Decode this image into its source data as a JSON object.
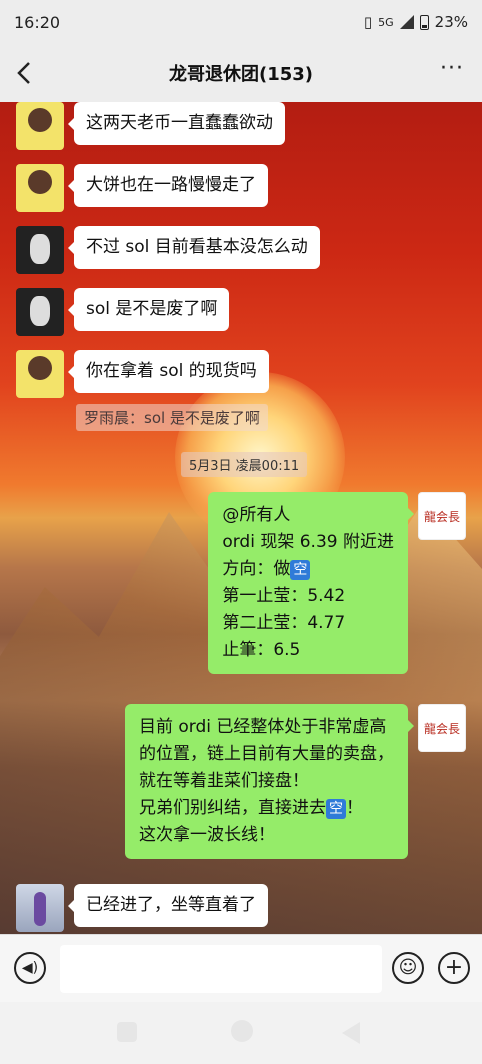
{
  "status": {
    "time": "16:20",
    "network": "5G",
    "battery": "23%"
  },
  "header": {
    "title": "龙哥退休团(153)"
  },
  "messages": {
    "m1": "这两天老币一直蠢蠢欲动",
    "m2": "大饼也在一路慢慢走了",
    "m3": "不过 sol 目前看基本没怎么动",
    "m4": "sol 是不是废了啊",
    "m5": "你在拿着 sol 的现货吗",
    "quote": "罗雨晨：sol 是不是废了啊",
    "timestamp": "5月3日 凌晨00:11",
    "m6": {
      "line1": "@所有人",
      "line2": "ordi 现架 6.39 附近进",
      "line3a": "方向：做",
      "line3b": "空",
      "line4": "第一止莹：5.42",
      "line5": "第二止莹：4.77",
      "line6": "止筆：6.5"
    },
    "m7": {
      "line1": "目前 ordi 已经整体处于非常虚高",
      "line2": "的位置，链上目前有大量的卖盘，",
      "line3": "就在等着韭菜们接盘！",
      "line4a": "兄弟们别纠结，直接进去",
      "line4b": "空",
      "line4c": "！",
      "line5": "这次拿一波长线！"
    },
    "m8": "已经进了，坐等直着了"
  },
  "avatars": {
    "logo_text": "龍会長"
  }
}
